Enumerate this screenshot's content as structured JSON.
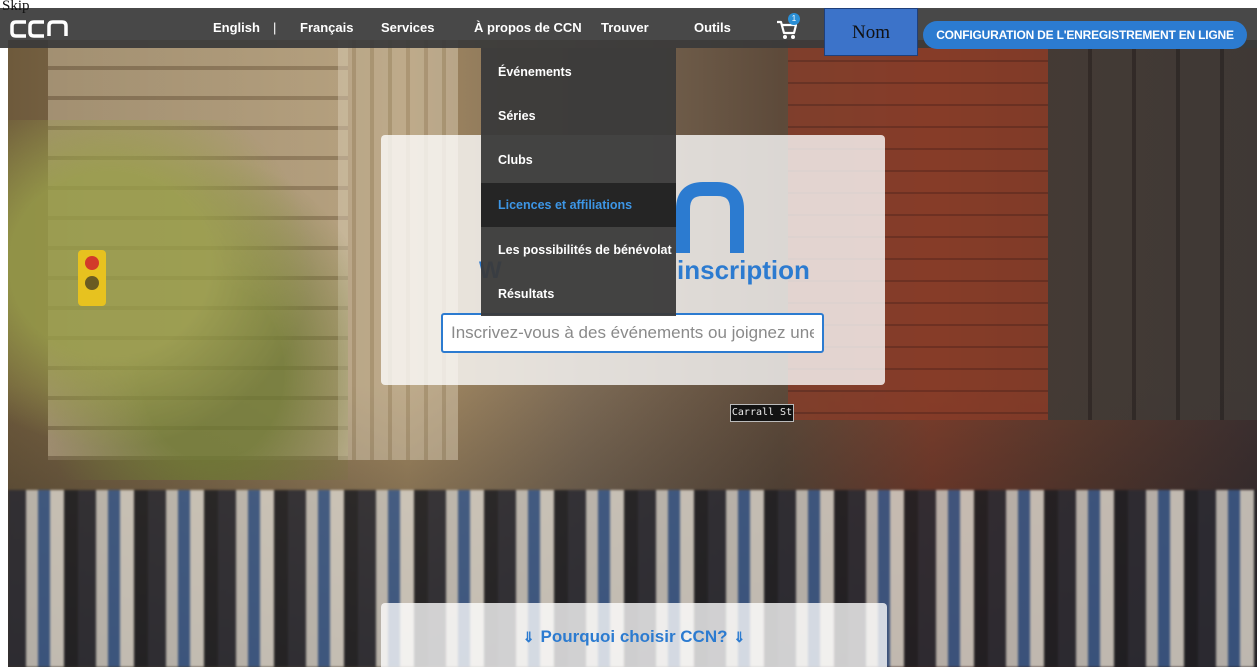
{
  "skip_link": "Skip",
  "header": {
    "logo_alt": "CCN",
    "nav": {
      "english": "English",
      "separator": "|",
      "francais": "Français",
      "services": "Services",
      "about": "À propos de CCN",
      "find": "Trouver",
      "tools": "Outils"
    },
    "cart_icon": "cart-icon",
    "cart_count": "1",
    "name_button": "Nom",
    "config_button": "CONFIGURATION DE L'ENREGISTREMENT EN LIGNE"
  },
  "dropdown": {
    "items": [
      {
        "label": "Événements",
        "active": false
      },
      {
        "label": "Séries",
        "active": false
      },
      {
        "label": "Clubs",
        "active": false
      },
      {
        "label": "Licences et affiliations",
        "active": true
      },
      {
        "label": "Les possibilités de bénévolat",
        "active": false
      },
      {
        "label": "Résultats",
        "active": false
      }
    ]
  },
  "card": {
    "title_lead": "W",
    "title": "inscription",
    "search_placeholder": "Inscrivez-vous à des événements ou joignez une"
  },
  "hero": {
    "street_sign": "Carrall St"
  },
  "why": {
    "label": "Pourquoi choisir CCN?",
    "chevron_icon": "double-chevron-down-icon"
  },
  "colors": {
    "header_bg": "#3a3a3a",
    "accent_blue": "#2c7bd0",
    "active_link": "#3d96e6",
    "name_button_bg": "#3c73c9"
  }
}
